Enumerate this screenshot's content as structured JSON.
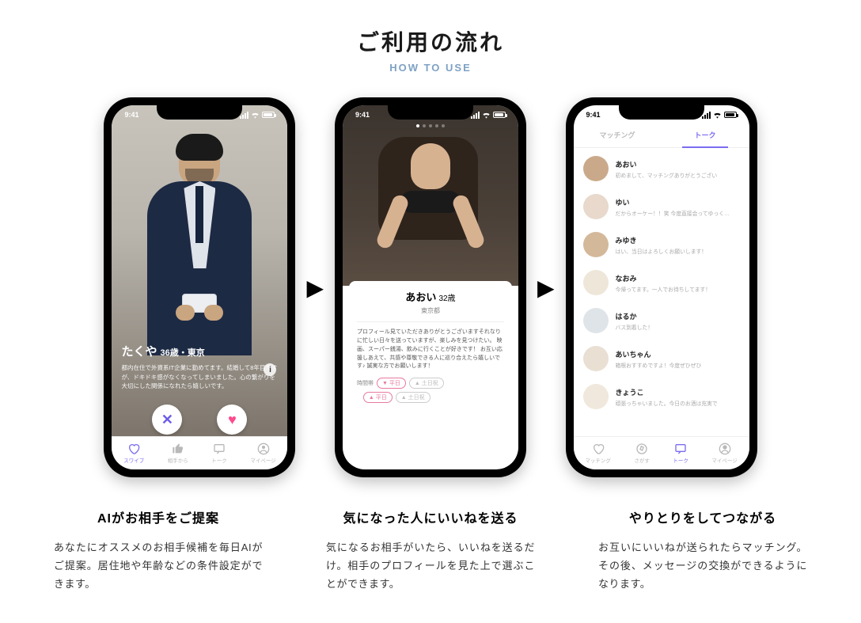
{
  "header": {
    "title": "ご利用の流れ",
    "subtitle": "HOW TO USE"
  },
  "status_time": "9:41",
  "phone1": {
    "name": "たくや",
    "meta": "36歳・東京",
    "bio": "都内在住で外資系IT企業に勤めてます。結婚して8年目ですが、ドキドキ感がなくなってしまいました。心の繋がりを大切にした関係になれたら嬉しいです。",
    "tabs": [
      "スワイプ",
      "相手から",
      "トーク",
      "マイページ"
    ]
  },
  "phone2": {
    "name": "あおい",
    "age": "32歳",
    "location": "東京都",
    "bio": "プロフィール見ていただきありがとうございますそれなりに忙しい日々を送っていますが、楽しみを見つけたい。\n映画、スーパー銭湯、飲みに行くことが好きです！\nお互い応援しあえて、共感や尊敬できる人に巡り合えたら嬉しいです♪\n誠実な方でお願いします！",
    "tag_label": "時間帯",
    "tags": [
      {
        "text": "▼ 平日",
        "on": true
      },
      {
        "text": "▲ 土日祝",
        "on": false
      },
      {
        "text": "▲ 平日",
        "on": true
      },
      {
        "text": "▲ 土日祝",
        "on": false
      }
    ]
  },
  "phone3": {
    "tabs": [
      "マッチング",
      "トーク"
    ],
    "active_tab": 1,
    "chats": [
      {
        "name": "あおい",
        "msg": "初めまして、マッチングありがとうござい",
        "bg": "#caa98a"
      },
      {
        "name": "ゆい",
        "msg": "だからオーケー！！笑 今度直接会ってゆっく…",
        "bg": "#e8d9cc"
      },
      {
        "name": "みゆき",
        "msg": "はい、当日はよろしくお願いします！",
        "bg": "#d4b89a"
      },
      {
        "name": "なおみ",
        "msg": "今帰ってます。一人でお待ちしてます！",
        "bg": "#efe6da"
      },
      {
        "name": "はるか",
        "msg": "バス到着した！",
        "bg": "#dfe4e8"
      },
      {
        "name": "あいちゃん",
        "msg": "箱根おすすめですよ！今度ぜひぜひ",
        "bg": "#e9dfd3"
      },
      {
        "name": "きょうこ",
        "msg": "頑張っちゃいました。今日のお酒は充実で",
        "bg": "#f0e8dc"
      }
    ],
    "bottom_tabs": [
      "マッチング",
      "さがす",
      "トーク",
      "マイページ"
    ]
  },
  "steps": [
    {
      "title": "AIがお相手をご提案",
      "body": "あなたにオススメのお相手候補を毎日AIがご提案。居住地や年齢などの条件設定ができます。"
    },
    {
      "title": "気になった人にいいねを送る",
      "body": "気になるお相手がいたら、いいねを送るだけ。相手のプロフィールを見た上で選ぶことができます。"
    },
    {
      "title": "やりとりをしてつながる",
      "body": "お互いにいいねが送られたらマッチング。その後、メッセージの交換ができるようになります。"
    }
  ]
}
